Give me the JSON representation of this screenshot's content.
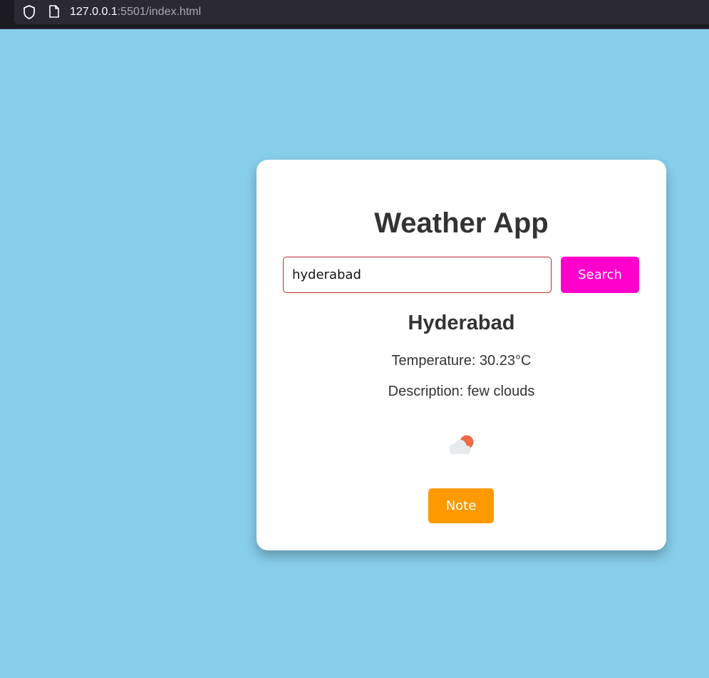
{
  "browser": {
    "url_host": "127.0.0.1",
    "url_rest": ":5501/index.html"
  },
  "app": {
    "title": "Weather App",
    "search": {
      "value": "hyderabad",
      "button_label": "Search"
    },
    "result": {
      "city": "Hyderabad",
      "temperature": "Temperature: 30.23°C",
      "description": "Description: few clouds",
      "icon": "few-clouds-day-icon"
    },
    "note_label": "Note"
  },
  "colors": {
    "page_background": "#87ceeb",
    "search_button": "#ff00cc",
    "note_button": "#ff9900",
    "input_border": "#c0262d",
    "text": "#333333"
  }
}
